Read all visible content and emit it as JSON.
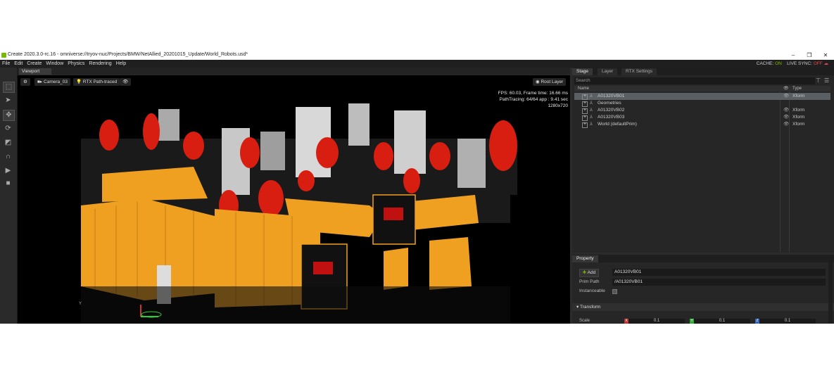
{
  "window": {
    "title": "Create 2020.3.0-rc.16 - omniverse://tryov-nuc/Projects/BMW/NetAllied_20201015_Update/World_Robots.usd*",
    "controls": [
      "–",
      "❐",
      "✕"
    ]
  },
  "menu": {
    "items": [
      "File",
      "Edit",
      "Create",
      "Window",
      "Physics",
      "Rendering",
      "Help"
    ],
    "cache_label": "CACHE:",
    "cache_value": "ON",
    "live_sync_label": "LIVE SYNC:",
    "live_sync_value": "OFF"
  },
  "viewport": {
    "tab": "Viewport",
    "camera": "Camera_03",
    "render_mode": "RTX Path-traced",
    "layer": "Root Layer",
    "stats": [
      "FPS: 60.03, Frame time: 16.66 ms",
      "PathTracing: 64/64 app : 9.41 sec",
      "1280x720"
    ],
    "axis_label": "Y"
  },
  "stage": {
    "tabs": [
      "Stage",
      "Layer",
      "RTX Settings"
    ],
    "search_placeholder": "Search",
    "columns": {
      "name": "Name",
      "type": "Type"
    },
    "rows": [
      {
        "name": "A01320VB01",
        "type": "Xform",
        "selected": true
      },
      {
        "name": "Geometries",
        "type": "",
        "selected": false
      },
      {
        "name": "A01320VB02",
        "type": "Xform",
        "selected": false
      },
      {
        "name": "A01320VB03",
        "type": "Xform",
        "selected": false
      },
      {
        "name": "World (defaultPrim)",
        "type": "Xform",
        "selected": false
      }
    ]
  },
  "property": {
    "tab": "Property",
    "add_label": "Add",
    "name_value": "A01320VB01",
    "prim_path_label": "Prim Path",
    "prim_path_value": "/A01320VB01",
    "instanceable_label": "Instanceable",
    "transform_label": "Transform",
    "scale_label": "Scale",
    "scale_axes": [
      "X",
      "Y",
      "Z"
    ],
    "scale_values": [
      "0.1",
      "0.1",
      "0.1"
    ]
  },
  "colors": {
    "accent_on": "#76b900",
    "accent_off": "#e04a4a",
    "robot": "#d81e10",
    "fence": "#f0a020"
  }
}
